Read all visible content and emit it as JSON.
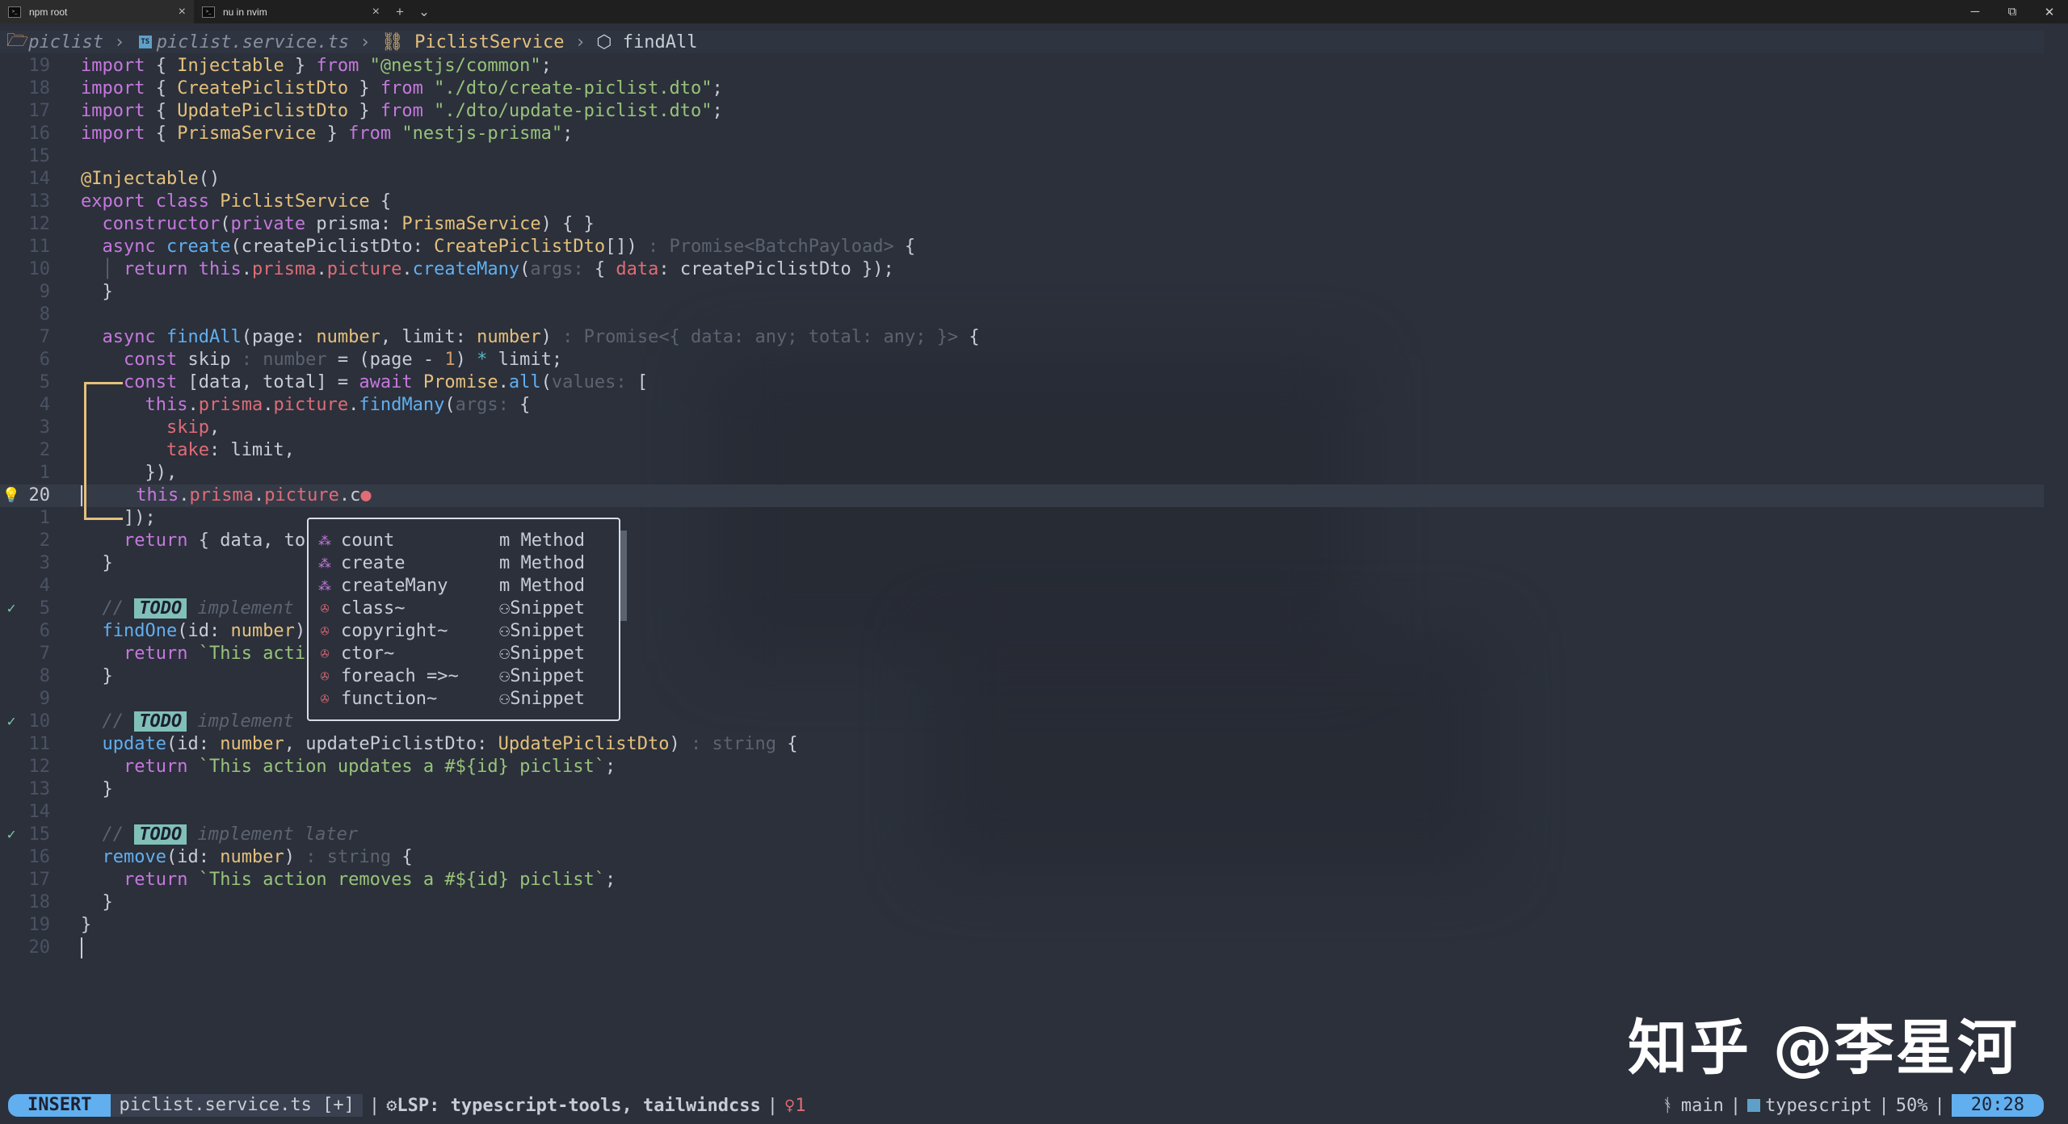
{
  "tabs": [
    {
      "title": "npm root",
      "icon": "terminal-icon",
      "active": true
    },
    {
      "title": "nu in nvim",
      "icon": "terminal-icon",
      "active": false
    }
  ],
  "tab_controls": {
    "new_tab": "+",
    "dropdown": "⌄"
  },
  "window_controls": {
    "minimize": "─",
    "maximize": "⧉",
    "close": "✕"
  },
  "winbar": {
    "folder": "piclist",
    "file": "piclist.service.ts",
    "class": "PiclistService",
    "method": "findAll",
    "separator": "›"
  },
  "code_lines": [
    {
      "num": "19"
    },
    {
      "num": "18"
    },
    {
      "num": "17"
    },
    {
      "num": "16"
    },
    {
      "num": "15"
    },
    {
      "num": "14"
    },
    {
      "num": "13"
    },
    {
      "num": "12"
    },
    {
      "num": "11"
    },
    {
      "num": "10"
    },
    {
      "num": "9"
    },
    {
      "num": "8"
    },
    {
      "num": "7"
    },
    {
      "num": "6"
    },
    {
      "num": "5"
    },
    {
      "num": "4"
    },
    {
      "num": "3"
    },
    {
      "num": "2"
    },
    {
      "num": "1"
    },
    {
      "num": "20"
    },
    {
      "num": "1"
    },
    {
      "num": "2"
    },
    {
      "num": "3"
    },
    {
      "num": "4"
    },
    {
      "num": "5"
    },
    {
      "num": "6"
    },
    {
      "num": "7"
    },
    {
      "num": "8"
    },
    {
      "num": "9"
    },
    {
      "num": "10"
    },
    {
      "num": "11"
    },
    {
      "num": "12"
    },
    {
      "num": "13"
    },
    {
      "num": "14"
    },
    {
      "num": "15"
    },
    {
      "num": "16"
    },
    {
      "num": "17"
    },
    {
      "num": "18"
    },
    {
      "num": "19"
    },
    {
      "num": "20"
    }
  ],
  "completion": {
    "items": [
      {
        "label": "count",
        "kind": "m Method",
        "icon": "method-icon"
      },
      {
        "label": "create",
        "kind": "m Method",
        "icon": "method-icon"
      },
      {
        "label": "createMany",
        "kind": "m Method",
        "icon": "method-icon"
      },
      {
        "label": "class~",
        "kind": "Snippet",
        "icon": "snippet-icon"
      },
      {
        "label": "copyright~",
        "kind": "Snippet",
        "icon": "snippet-icon"
      },
      {
        "label": "ctor~",
        "kind": "Snippet",
        "icon": "snippet-icon"
      },
      {
        "label": "foreach =>~",
        "kind": "Snippet",
        "icon": "snippet-icon"
      },
      {
        "label": "function~",
        "kind": "Snippet",
        "icon": "snippet-icon"
      }
    ]
  },
  "todo_label": "TODO",
  "watermark": "知乎 @李星河",
  "statusline": {
    "mode": "INSERT",
    "file": "piclist.service.ts [+]",
    "lsp": "LSP: typescript-tools, tailwindcss",
    "diagnostics": "1",
    "branch": "main",
    "filetype": "typescript",
    "percent": "50%",
    "position": "20:28"
  },
  "colors": {
    "background": "#2b303b",
    "keyword": "#c678dd",
    "function": "#61afef",
    "string": "#98c379",
    "type": "#e5c07b",
    "mode_bg": "#61afef"
  }
}
